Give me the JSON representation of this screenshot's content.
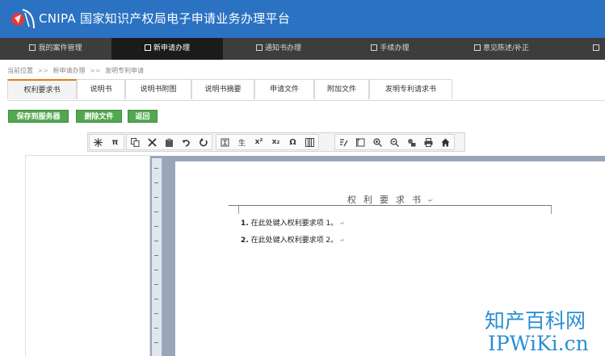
{
  "header": {
    "brand": "CNIPA",
    "title": "国家知识产权局电子申请业务办理平台"
  },
  "nav": {
    "items": [
      {
        "label": "我的案件管理",
        "icon": "home-icon"
      },
      {
        "label": "新申请办理",
        "icon": "edit-icon",
        "active": true
      },
      {
        "label": "通知书办理",
        "icon": "inbox-icon"
      },
      {
        "label": "手续办理",
        "icon": "file-icon"
      },
      {
        "label": "意见陈述/补正",
        "icon": "message-icon"
      },
      {
        "label": "",
        "icon": "more-icon"
      }
    ]
  },
  "breadcrumb": {
    "prefix": "当前位置",
    "sep": ">>",
    "items": [
      "新申请办理",
      "发明专利申请"
    ]
  },
  "tabs": [
    {
      "label": "权利要求书",
      "active": true
    },
    {
      "label": "说明书"
    },
    {
      "label": "说明书附图"
    },
    {
      "label": "说明书摘要"
    },
    {
      "label": "申请文件"
    },
    {
      "label": "附加文件"
    },
    {
      "label": "发明专利请求书"
    }
  ],
  "actions": {
    "save": "保存到服务器",
    "delete": "删除文件",
    "back": "返回"
  },
  "toolbar": {
    "pi_label": "π",
    "superscript_label": "x²",
    "subscript_label": "x₂",
    "omega_label": "Ω",
    "rare_char_label": "生"
  },
  "document": {
    "title": "权利要求书",
    "para_mark": "↵",
    "claims": [
      {
        "num": "1.",
        "text": "在此处键入权利要求项 1。"
      },
      {
        "num": "2.",
        "text": "在此处键入权利要求项 2。"
      }
    ]
  },
  "watermark": {
    "line1": "知产百科网",
    "line2": "IPWiKi.cn"
  },
  "colors": {
    "header_bg": "#2b72c2",
    "nav_bg": "#3d3d3d",
    "nav_active_bg": "#1b1b1b",
    "tab_accent": "#e07b1a",
    "button_green": "#52a84e",
    "watermark": "#2a8fd4"
  }
}
